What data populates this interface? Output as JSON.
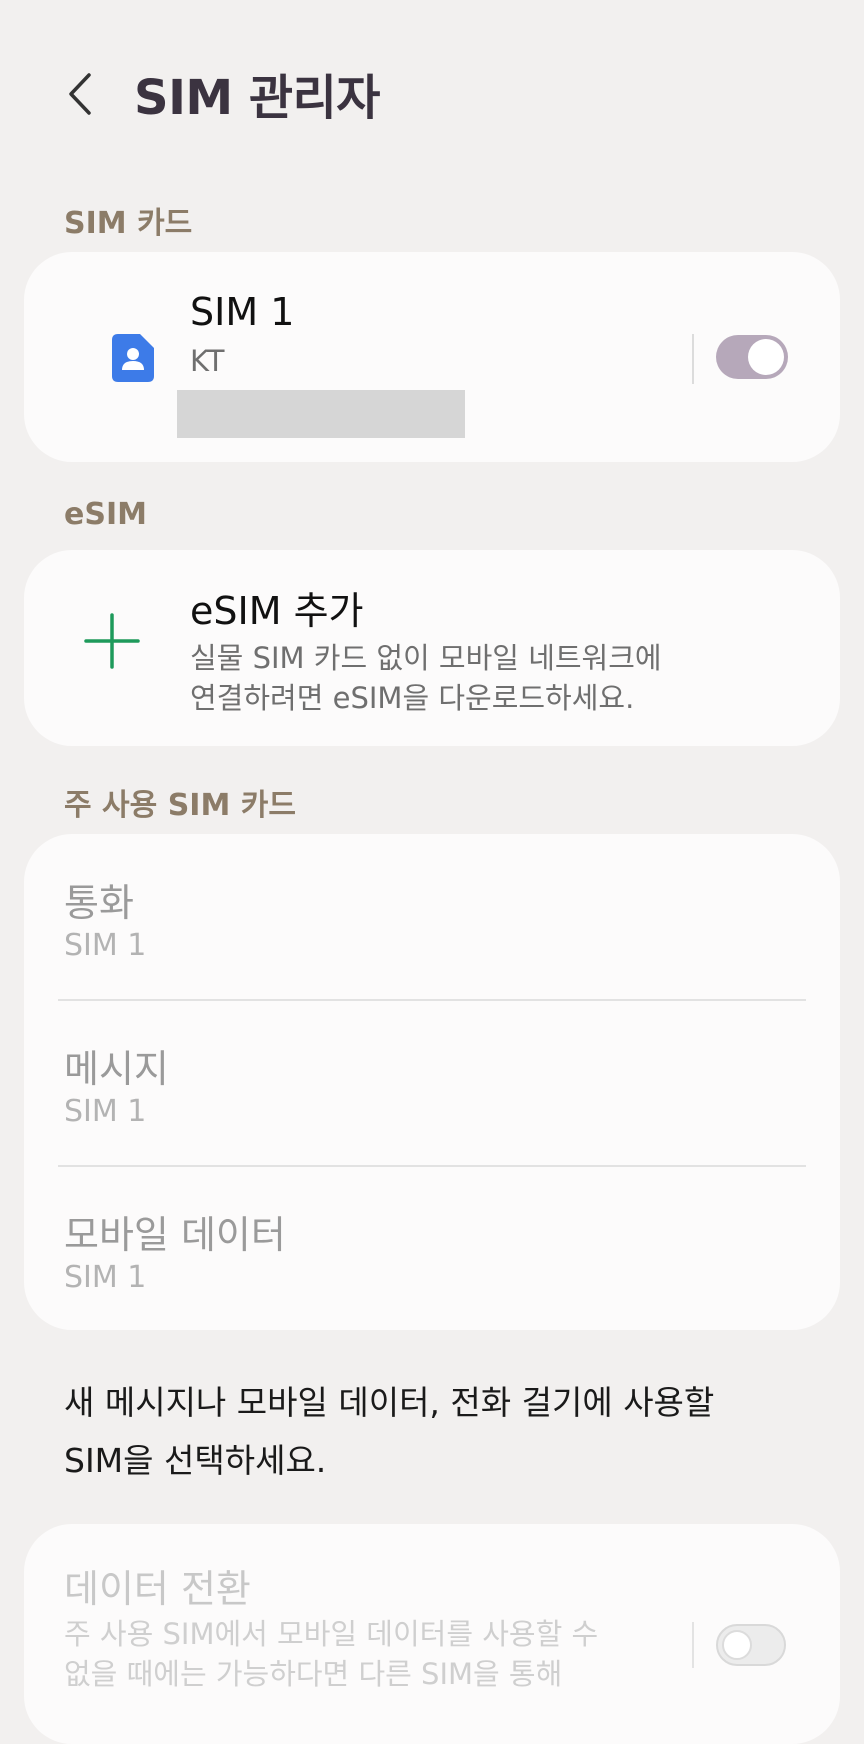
{
  "header": {
    "title": "SIM 관리자",
    "back_icon": "chevron-left-icon"
  },
  "sections": {
    "sim_card_label": "SIM 카드",
    "esim_label": "eSIM",
    "preferred_label": "주 사용 SIM 카드"
  },
  "sim1": {
    "name": "SIM 1",
    "carrier": "KT",
    "icon": "sim-card-icon",
    "icon_color": "#3d7be8",
    "enabled": true
  },
  "esim": {
    "title": "eSIM 추가",
    "description_line1": "실물 SIM 카드 없이 모바일 네트워크에",
    "description_line2": "연결하려면 eSIM을 다운로드하세요.",
    "icon": "plus-icon",
    "icon_color": "#1e9a5b"
  },
  "preferred": {
    "items": [
      {
        "label": "통화",
        "value": "SIM 1"
      },
      {
        "label": "메시지",
        "value": "SIM 1"
      },
      {
        "label": "모바일 데이터",
        "value": "SIM 1"
      }
    ]
  },
  "footnote": {
    "line1": "새 메시지나 모바일 데이터, 전화 걸기에 사용할",
    "line2": "SIM을 선택하세요."
  },
  "data_switch": {
    "title": "데이터 전환",
    "description_line1": "주 사용 SIM에서 모바일 데이터를 사용할 수",
    "description_line2": "없을 때에는 가능하다면 다른 SIM을 통해",
    "enabled": false
  }
}
